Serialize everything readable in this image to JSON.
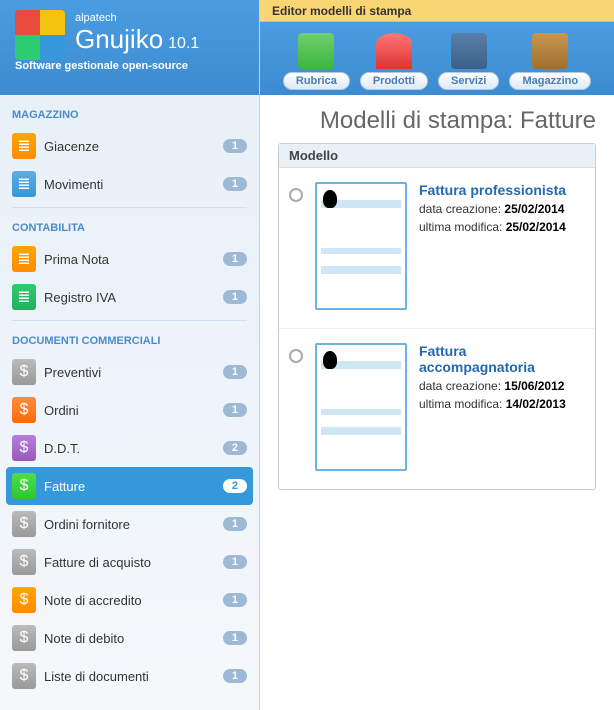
{
  "header": {
    "company": "alpatech",
    "product": "Gnujiko",
    "version": "10.1",
    "tagline": "Software gestionale open-source"
  },
  "topbar_title": "Editor modelli di stampa",
  "toolbar": [
    {
      "label": "Rubrica",
      "icon": "address-book-icon",
      "cls": "ti-green"
    },
    {
      "label": "Prodotti",
      "icon": "tag-icon",
      "cls": "ti-red"
    },
    {
      "label": "Servizi",
      "icon": "toolbox-icon",
      "cls": "ti-blue"
    },
    {
      "label": "Magazzino",
      "icon": "box-icon",
      "cls": "ti-brown"
    }
  ],
  "sidebar": {
    "sections": [
      {
        "title": "MAGAZZINO",
        "items": [
          {
            "label": "Giacenze",
            "count": "1",
            "icon": "doc-icon",
            "cls": "ico-orange"
          },
          {
            "label": "Movimenti",
            "count": "1",
            "icon": "doc-icon",
            "cls": "ico-blue"
          }
        ]
      },
      {
        "title": "CONTABILITA",
        "items": [
          {
            "label": "Prima Nota",
            "count": "1",
            "icon": "doc-icon",
            "cls": "ico-orange"
          },
          {
            "label": "Registro IVA",
            "count": "1",
            "icon": "doc-icon",
            "cls": "ico-green"
          }
        ]
      },
      {
        "title": "DOCUMENTI COMMERCIALI",
        "items": [
          {
            "label": "Preventivi",
            "count": "1",
            "icon": "dollar-icon",
            "cls": "ico-gray"
          },
          {
            "label": "Ordini",
            "count": "1",
            "icon": "dollar-icon",
            "cls": "ico-brightorange"
          },
          {
            "label": "D.D.T.",
            "count": "2",
            "icon": "dollar-icon",
            "cls": "ico-purple"
          },
          {
            "label": "Fatture",
            "count": "2",
            "icon": "dollar-icon",
            "cls": "ico-brightgreen",
            "active": true
          },
          {
            "label": "Ordini fornitore",
            "count": "1",
            "icon": "dollar-icon",
            "cls": "ico-gray"
          },
          {
            "label": "Fatture di acquisto",
            "count": "1",
            "icon": "dollar-icon",
            "cls": "ico-gray"
          },
          {
            "label": "Note di accredito",
            "count": "1",
            "icon": "dollar-icon",
            "cls": "ico-orange"
          },
          {
            "label": "Note di debito",
            "count": "1",
            "icon": "dollar-icon",
            "cls": "ico-gray"
          },
          {
            "label": "Liste di documenti",
            "count": "1",
            "icon": "dollar-icon",
            "cls": "ico-gray"
          }
        ]
      }
    ]
  },
  "page_title": "Modelli di stampa: Fatture",
  "model_header": "Modello",
  "labels": {
    "created": "data creazione:",
    "modified": "ultima modifica:"
  },
  "models": [
    {
      "name": "Fattura professionista",
      "created": "25/02/2014",
      "modified": "25/02/2014"
    },
    {
      "name": "Fattura accompagnatoria",
      "created": "15/06/2012",
      "modified": "14/02/2013"
    }
  ]
}
